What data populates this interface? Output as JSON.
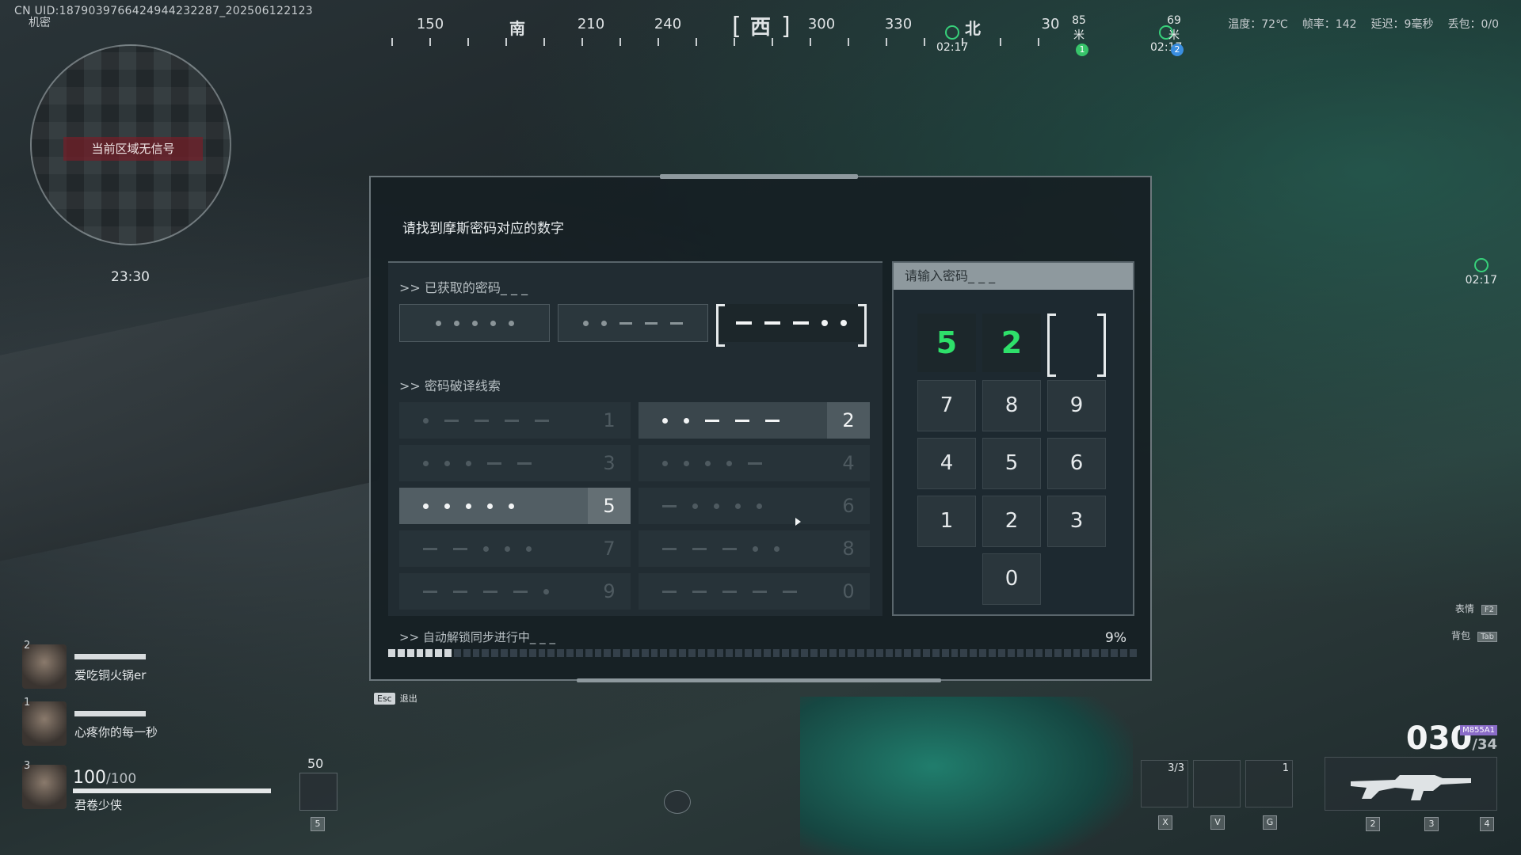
{
  "hud": {
    "uid": "CN UID:1879039766424944232287_202506122123",
    "secret": "机密",
    "compass": {
      "labels": [
        {
          "text": "150",
          "pos": 103
        },
        {
          "text": "南",
          "pos": 213,
          "dir": true
        },
        {
          "text": "210",
          "pos": 306
        },
        {
          "text": "240",
          "pos": 403
        },
        {
          "text": "西",
          "pos": 520,
          "active": true
        },
        {
          "text": "300",
          "pos": 597
        },
        {
          "text": "330",
          "pos": 694
        },
        {
          "text": "北",
          "pos": 788,
          "dir": true
        },
        {
          "text": "30",
          "pos": 886
        }
      ],
      "markers": [
        {
          "time": "02:17",
          "pos": 742
        },
        {
          "time": "02:17",
          "pos": 1012
        }
      ],
      "distances": [
        {
          "text": "85米",
          "badge": "1",
          "color": "#37c46a"
        },
        {
          "text": "69米",
          "badge": "2",
          "color": "#3a8ee0"
        }
      ]
    },
    "stats": {
      "temperature": "温度：72℃",
      "fps": "帧率：142",
      "latency": "延迟：9毫秒",
      "packet_loss": "丢包：0/0"
    },
    "minimap": {
      "no_signal": "当前区域无信号",
      "time": "23:30"
    },
    "side_marker_time": "02:17"
  },
  "team": [
    {
      "index": "2",
      "name": "爱吃铜火锅er"
    },
    {
      "index": "1",
      "name": "心疼你的每一秒"
    },
    {
      "index": "3",
      "name": "君卷少侠"
    }
  ],
  "player": {
    "hp": "100",
    "hp_max": "/100",
    "armor": "50",
    "armor_key": "5"
  },
  "weapon": {
    "ammo": "030",
    "ammo_reserve": "/34",
    "weapon_tag": "M855A1",
    "equipment": [
      {
        "count": "3/3",
        "key": "X"
      },
      {
        "count": "",
        "key": "V"
      },
      {
        "count": "1",
        "key": "G"
      }
    ],
    "slots": [
      "2",
      "3",
      "4"
    ]
  },
  "shortcuts": [
    {
      "label": "表情",
      "key": "F2"
    },
    {
      "label": "背包",
      "key": "Tab"
    }
  ],
  "dialog": {
    "title": "请找到摩斯密码对应的数字",
    "obtained_label": ">> 已获取的密码_ _ _",
    "obtained": [
      {
        "code": [
          ".",
          ".",
          ".",
          ".",
          "."
        ]
      },
      {
        "code": [
          ".",
          ".",
          "-",
          "-",
          "-"
        ]
      },
      {
        "code": [
          "-",
          "-",
          "-",
          ".",
          "."
        ],
        "active": true
      }
    ],
    "clues_label": ">> 密码破译线索",
    "clues": [
      {
        "code": [
          ".",
          "-",
          "-",
          "-",
          "-"
        ],
        "num": "1"
      },
      {
        "code": [
          ".",
          ".",
          "-",
          "-",
          "-"
        ],
        "num": "2",
        "state": "lit"
      },
      {
        "code": [
          ".",
          ".",
          ".",
          "-",
          "-"
        ],
        "num": "3"
      },
      {
        "code": [
          ".",
          ".",
          ".",
          ".",
          "-"
        ],
        "num": "4"
      },
      {
        "code": [
          ".",
          ".",
          ".",
          ".",
          "."
        ],
        "num": "5",
        "state": "hl"
      },
      {
        "code": [
          "-",
          ".",
          ".",
          ".",
          "."
        ],
        "num": "6"
      },
      {
        "code": [
          "-",
          "-",
          ".",
          ".",
          "."
        ],
        "num": "7"
      },
      {
        "code": [
          "-",
          "-",
          "-",
          ".",
          "."
        ],
        "num": "8"
      },
      {
        "code": [
          "-",
          "-",
          "-",
          "-",
          "."
        ],
        "num": "9"
      },
      {
        "code": [
          "-",
          "-",
          "-",
          "-",
          "-"
        ],
        "num": "0"
      }
    ],
    "sync_label": ">> 自动解锁同步进行中_ _ _",
    "progress_percent": "9%",
    "progress_value": 0.09,
    "input_label": "请输入密码_ _ _",
    "entered": [
      "5",
      "2",
      ""
    ],
    "keypad": [
      "7",
      "8",
      "9",
      "4",
      "5",
      "6",
      "1",
      "2",
      "3",
      "0"
    ],
    "exit_key": "Esc",
    "exit_label": "退出"
  }
}
